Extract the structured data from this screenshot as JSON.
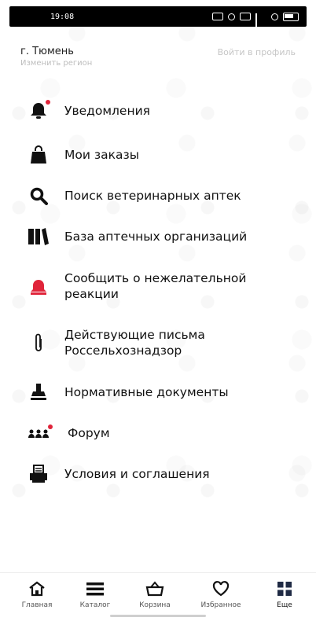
{
  "status_bar": {
    "time": "19:08"
  },
  "header": {
    "city": "г. Тюмень",
    "region_hint": "Изменить регион",
    "login_link": "Войти в профиль"
  },
  "menu": {
    "items": [
      {
        "label": "Уведомления",
        "icon": "bell-icon",
        "badge": true
      },
      {
        "label": "Мои заказы",
        "icon": "shopping-bag-icon",
        "badge": false
      },
      {
        "label": "Поиск ветеринарных аптек",
        "icon": "search-icon",
        "badge": false
      },
      {
        "label": "База аптечных организаций",
        "icon": "binders-icon",
        "badge": false
      },
      {
        "label_line1": "Сообщить о нежелательной",
        "label_line2": "реакции",
        "icon": "alarm-bell-icon",
        "badge": false,
        "accent": "#e0243a"
      },
      {
        "label_line1": "Действующие письма",
        "label_line2": "Россельхознадзор",
        "icon": "paperclip-icon",
        "badge": false
      },
      {
        "label": "Нормативные документы",
        "icon": "stamp-icon",
        "badge": false
      },
      {
        "label": "Форум",
        "icon": "people-icon",
        "badge": true
      },
      {
        "label": "Условия и соглашения",
        "icon": "printer-document-icon",
        "badge": false
      }
    ]
  },
  "bottom_nav": {
    "items": [
      {
        "label": "Главная",
        "icon": "home-icon"
      },
      {
        "label": "Каталог",
        "icon": "menu-lines-icon"
      },
      {
        "label": "Корзина",
        "icon": "basket-icon"
      },
      {
        "label": "Избранное",
        "icon": "heart-icon"
      },
      {
        "label": "Еще",
        "icon": "grid-icon",
        "active": true
      }
    ]
  },
  "colors": {
    "accent_red": "#e0243a",
    "text": "#111111",
    "muted": "#bdbdbd"
  }
}
